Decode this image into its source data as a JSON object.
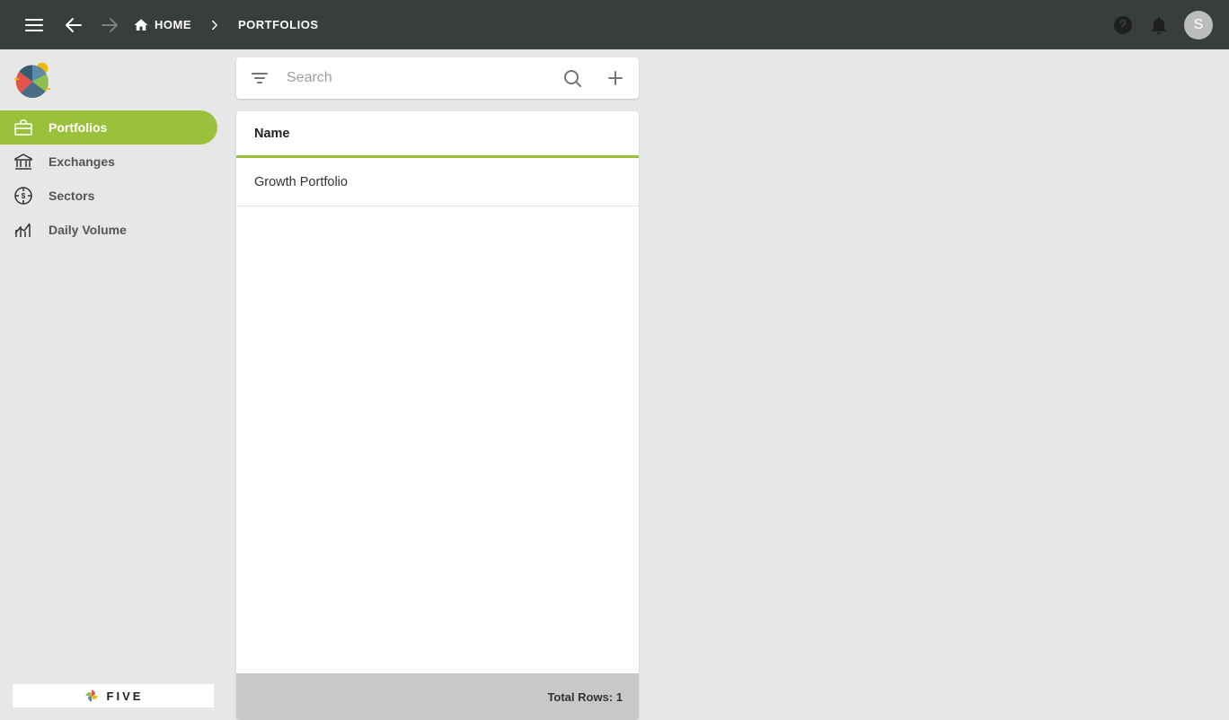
{
  "topbar": {
    "home_label": "HOME",
    "current_crumb": "PORTFOLIOS",
    "avatar_initial": "S"
  },
  "sidebar": {
    "items": [
      {
        "label": "Portfolios",
        "icon": "briefcase-icon",
        "active": true
      },
      {
        "label": "Exchanges",
        "icon": "bank-icon",
        "active": false
      },
      {
        "label": "Sectors",
        "icon": "target-icon",
        "active": false
      },
      {
        "label": "Daily Volume",
        "icon": "chart-icon",
        "active": false
      }
    ],
    "footer_brand": "FIVE"
  },
  "search": {
    "placeholder": "Search"
  },
  "list": {
    "header": "Name",
    "rows": [
      {
        "name": "Growth Portfolio"
      }
    ],
    "footer_label": "Total Rows:",
    "footer_count": "1"
  },
  "colors": {
    "accent": "#9bc03b",
    "topbar": "#383e3b",
    "bg": "#e7e7e7"
  }
}
